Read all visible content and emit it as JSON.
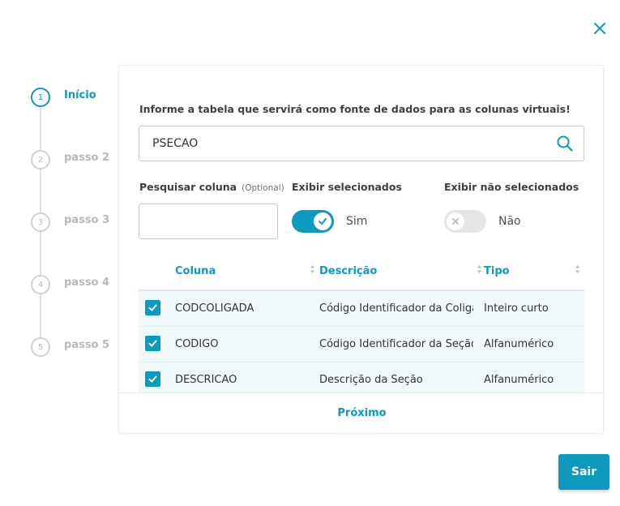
{
  "colors": {
    "accent": "#0c9abe",
    "inactive": "#b4b9bd",
    "row_bg": "#f1f8fa"
  },
  "stepper": {
    "steps": [
      {
        "number": "1",
        "label": "Início",
        "active": true
      },
      {
        "number": "2",
        "label": "passo 2",
        "active": false
      },
      {
        "number": "3",
        "label": "passo 3",
        "active": false
      },
      {
        "number": "4",
        "label": "passo 4",
        "active": false
      },
      {
        "number": "5",
        "label": "passo 5",
        "active": false
      }
    ]
  },
  "form": {
    "source_label": "Informe a tabela que servirá como fonte de dados para as colunas virtuais!",
    "source_value": "PSECAO",
    "search_icon": "search-icon",
    "column_search_label": "Pesquisar coluna",
    "column_search_optional": "(Optional)",
    "column_search_value": "",
    "show_selected_label": "Exibir selecionados",
    "show_selected_state": "Sim",
    "show_unselected_label": "Exibir não selecionados",
    "show_unselected_state": "Não"
  },
  "table": {
    "headers": {
      "column": "Coluna",
      "description": "Descrição",
      "type": "Tipo"
    },
    "rows": [
      {
        "checked": true,
        "column": "CODCOLIGADA",
        "description": "Código Identificador da Coligada",
        "type": "Inteiro curto"
      },
      {
        "checked": true,
        "column": "CODIGO",
        "description": "Código Identificador da Seção",
        "type": "Alfanumérico"
      },
      {
        "checked": true,
        "column": "DESCRICAO",
        "description": "Descrição da Seção",
        "type": "Alfanumérico"
      }
    ]
  },
  "footer": {
    "next_label": "Próximo"
  },
  "actions": {
    "exit_label": "Sair",
    "close_icon": "close-icon"
  }
}
